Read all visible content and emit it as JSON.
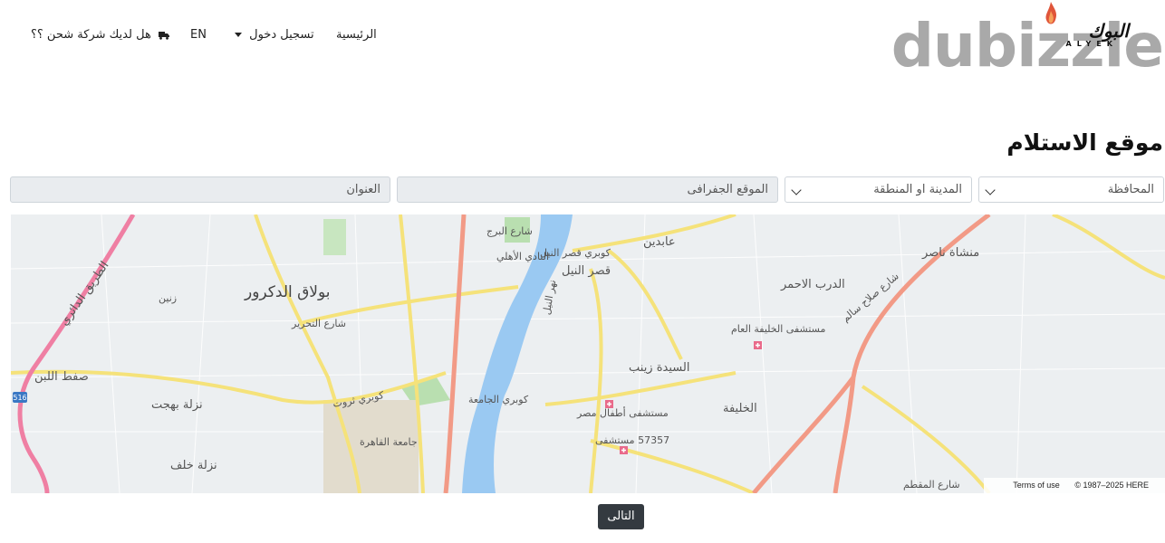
{
  "nav": {
    "home": "الرئيسية",
    "login": "تسجيل دخول",
    "lang": "EN",
    "shipping_company": "هل لديك شركة شحن ؟؟"
  },
  "logo": {
    "brand": "dubizzle",
    "arabic": "البوك",
    "latin": "ALYEK"
  },
  "page_title": "موقع الاستلام",
  "form": {
    "governorate": "المحافظة",
    "city_area": "المدينة او المنطقة",
    "geo_location": "الموقع الجفرافى",
    "address": "العنوان"
  },
  "map": {
    "labels": {
      "bulaq": "بولاق الدكرور",
      "qasr_nil": "قصر النيل",
      "abdeen": "عابدين",
      "darb_ahmar": "الدرب الاحمر",
      "manshiet_nasr": "منشاة ناصر",
      "sayeda_zeinab": "السيدة زينب",
      "khalifa": "الخليفة",
      "zeinin": "زنين",
      "saft_laban": "صفط اللبن",
      "nazlet_bahgat": "نزلة بهجت",
      "nazlet_khalaf": "نزلة خلف",
      "ring_road": "الطريق الدائري",
      "kobry_qasr_nil": "كوبري قصر النيل",
      "kobry_gamaa": "كوبري الجامعة",
      "cairo_uni": "جامعة القاهرة",
      "khalifa_hospital": "مستشفى الخليفة العام",
      "children_hospital": "مستشفى أطفال مصر",
      "hospital_57357": "57357 مستشفى",
      "salah_salem": "شارع صلاح سالم",
      "nile": "نهر النيل",
      "ahly_club": "النادي الأهلي",
      "road_516": "516",
      "kobry_tharwat": "كوبري ثروت",
      "burg_street": "شارع البرج",
      "tahrir_street": "شارع التحرير",
      "mokattam": "شارع المقطم"
    },
    "terms": "Terms of use",
    "copyright": "© 1987–2025 HERE"
  },
  "next_button": "التالى",
  "colors": {
    "dark_button": "#343a40",
    "map_yellow": "#f5e27a",
    "map_red": "#f29a86",
    "nile_blue": "#9ac9f2"
  }
}
